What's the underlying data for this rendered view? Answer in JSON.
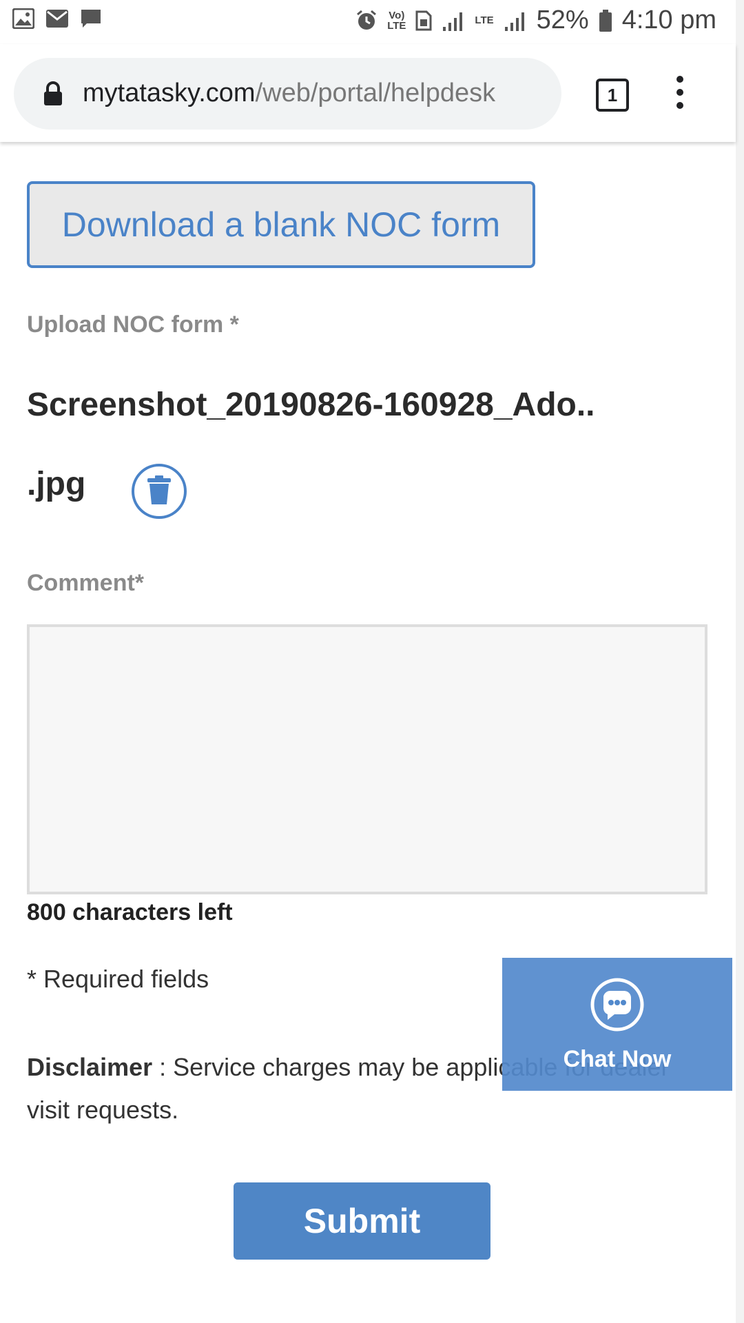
{
  "status_bar": {
    "volte": "Vo)",
    "volte_sub": "LTE",
    "lte": "LTE",
    "battery": "52%",
    "time": "4:10 pm"
  },
  "browser": {
    "url_host": "mytatasky.com",
    "url_path": "/web/portal/helpdesk",
    "tab_count": "1"
  },
  "form": {
    "download_button": "Download a blank NOC form",
    "upload_label": "Upload NOC form *",
    "file_name": "Screenshot_20190826-160928_Ado..",
    "file_ext": ".jpg",
    "comment_label": "Comment*",
    "comment_value": "",
    "chars_left": "800 characters left",
    "required_note": "* Required fields",
    "disclaimer_label": "Disclaimer",
    "disclaimer_text": " : Service charges may be applicable for dealer visit requests.",
    "submit_button": "Submit"
  },
  "chat": {
    "label": "Chat Now"
  },
  "colors": {
    "accent": "#4a83c8",
    "chat_bg": "#5289cc",
    "submit_bg": "#4f86c6"
  }
}
